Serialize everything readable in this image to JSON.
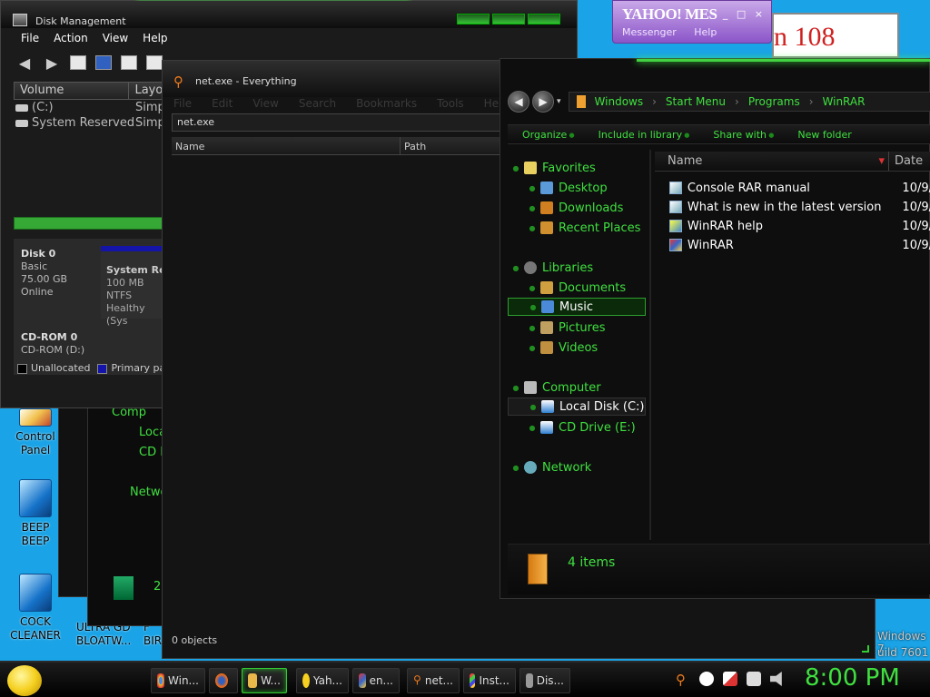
{
  "desktop": {
    "icons": [
      {
        "label": "Control Panel"
      },
      {
        "label": "BEEP BEEP"
      },
      {
        "label": "COCK CLEANER"
      }
    ],
    "partial_labels": [
      "ULTRA GD",
      "BLOATW...",
      "F",
      "BIR"
    ],
    "build_line1": "Windows 7",
    "build_line2": "uild 7601"
  },
  "yahoo": {
    "logo": "YAHOO! MES",
    "sub1": "Messenger",
    "sub2": "Help",
    "controls": "_ □ ×"
  },
  "disk_mgmt": {
    "title": "Disk Management",
    "menu": [
      "File",
      "Action",
      "View",
      "Help"
    ],
    "columns": [
      "Volume",
      "Layo"
    ],
    "volumes": [
      {
        "name": "(C:)",
        "layout": "Simp"
      },
      {
        "name": "System Reserved",
        "layout": "Simp"
      }
    ],
    "disk0": {
      "name": "Disk 0",
      "type": "Basic",
      "size": "75.00 GB",
      "status": "Online"
    },
    "partition": {
      "name": "System Re",
      "size": "100 MB NTFS",
      "status": "Healthy (Sys"
    },
    "cdrom": {
      "name": "CD-ROM 0",
      "drive": "CD-ROM (D:)"
    },
    "legend": [
      {
        "label": "Unallocated",
        "color": "#000000"
      },
      {
        "label": "Primary partiti",
        "color": "#1414a8"
      }
    ]
  },
  "everything": {
    "title": "net.exe - Everything",
    "menu": [
      "File",
      "Edit",
      "View",
      "Search",
      "Bookmarks",
      "Tools",
      "Help"
    ],
    "search_value": "net.exe",
    "columns": [
      "Name",
      "Path"
    ],
    "status": "0 objects"
  },
  "explorer": {
    "breadcrumb": [
      "Windows",
      "Start Menu",
      "Programs",
      "WinRAR"
    ],
    "commands": [
      "Organize",
      "Include in library",
      "Share with",
      "New folder"
    ],
    "nav": {
      "favorites": "Favorites",
      "desktop": "Desktop",
      "downloads": "Downloads",
      "recent": "Recent Places",
      "libraries": "Libraries",
      "documents": "Documents",
      "music": "Music",
      "pictures": "Pictures",
      "videos": "Videos",
      "computer": "Computer",
      "local_disk": "Local Disk (C:)",
      "cd_drive": "CD Drive (E:)",
      "network": "Network"
    },
    "columns": {
      "name": "Name",
      "date": "Date"
    },
    "files": [
      {
        "name": "Console RAR manual",
        "date": "10/9/"
      },
      {
        "name": "What is new in the latest version",
        "date": "10/9/"
      },
      {
        "name": "WinRAR help",
        "date": "10/9/"
      },
      {
        "name": "WinRAR",
        "date": "10/9/"
      }
    ],
    "item_count": "4 items"
  },
  "peek_explorer": {
    "computer": "Comp",
    "local": "Loca",
    "cd": "CD I",
    "network": "Netwo",
    "recycle_count": "2"
  },
  "taskbar": {
    "tasks": [
      {
        "label": "Win...",
        "icon": "chrome-icon",
        "color": "#e8c02c"
      },
      {
        "label": "",
        "icon": "firefox-icon",
        "color": "#e86a1c"
      },
      {
        "label": "W...",
        "icon": "folder-icon",
        "color": "#e8b84a"
      },
      {
        "label": "Yah...",
        "icon": "yahoo-smiley-icon",
        "color": "#f5d020"
      },
      {
        "label": "en...",
        "icon": "winrar-icon",
        "color": "#b03050"
      },
      {
        "label": "net...",
        "icon": "everything-icon",
        "color": "#f07a1a"
      },
      {
        "label": "Inst...",
        "icon": "windows-icon",
        "color": "#4aa0e8"
      },
      {
        "label": "Dis...",
        "icon": "disk-icon",
        "color": "#999999"
      }
    ],
    "clock": "8:00 PM"
  }
}
